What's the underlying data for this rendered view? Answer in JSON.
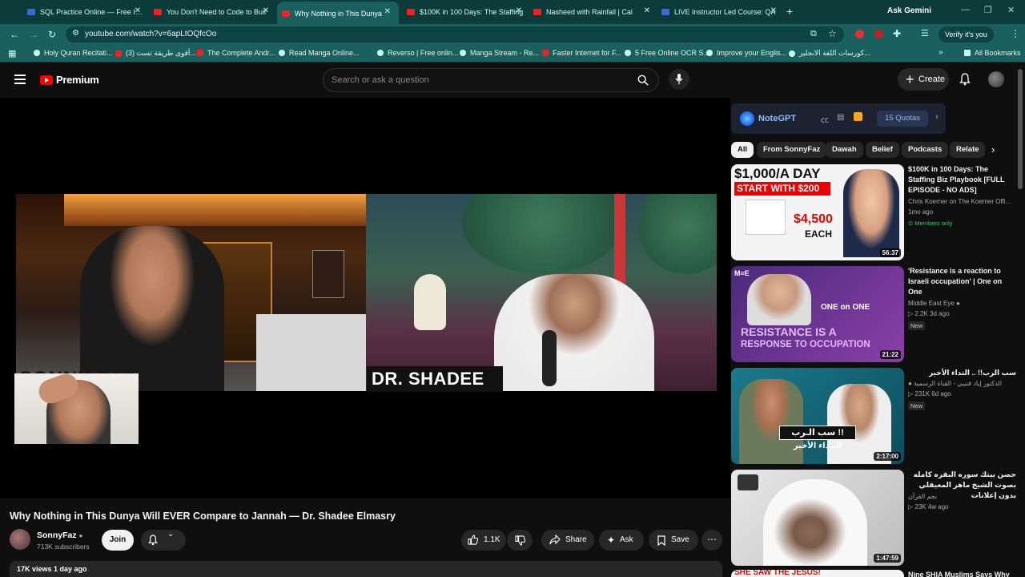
{
  "browser": {
    "tabs": [
      {
        "title": "SQL Practice Online — Free Inte",
        "fav": "blue"
      },
      {
        "title": "You Don't Need to Code to Buil",
        "fav": "red"
      },
      {
        "title": "Why Nothing in This Dunya",
        "fav": "red",
        "active": true
      },
      {
        "title": "$100K in 100 Days: The Staffing",
        "fav": "red"
      },
      {
        "title": "Nasheed with Rainfall | Cal",
        "fav": "red"
      },
      {
        "title": "LIVE Instructor Led Course: QA",
        "fav": "blue"
      }
    ],
    "new_tab": "+",
    "ask_gemini": "Ask Gemini",
    "url": "youtube.com/watch?v=6apLtOQfcOo",
    "verify": "Verify it's you",
    "bookmarks": [
      "Holy Quran Recitati...",
      "(3) أقوى طريقة تست...",
      "The Complete Andr...",
      "Read Manga Online...",
      "Reverso | Free onlin...",
      "Manga Stream - Re...",
      "Faster Internet for F...",
      "5 Free Online OCR S...",
      "Improve your Englis...",
      "كورسات اللغة الانجليز..."
    ],
    "all_bookmarks": "All Bookmarks"
  },
  "header": {
    "logo": "Premium",
    "search_placeholder": "Search or ask a question",
    "create": "Create"
  },
  "video": {
    "name_left": "SONNY FAZ",
    "name_right": "DR. SHADEE",
    "title": "Why Nothing in This Dunya Will EVER Compare to Jannah — Dr. Shadee Elmasry",
    "channel": "SonnyFaz",
    "subscribers": "713K subscribers",
    "join": "Join",
    "likes": "1.1K",
    "share": "Share",
    "ask": "Ask",
    "save": "Save",
    "stats": "17K views  1 day ago"
  },
  "notegpt": {
    "name": "NoteGPT",
    "quotas": "15 Quotas"
  },
  "chips": [
    "All",
    "From SonnyFaz",
    "Dawah",
    "Belief",
    "Podcasts",
    "Relate"
  ],
  "recommendations": [
    {
      "thumb_text_1": "$1,000/A DAY",
      "thumb_text_2": "START WITH $200",
      "thumb_text_3": "$4,500",
      "thumb_text_4": "EACH",
      "duration": "56:37",
      "title": "$100K in 100 Days: The Staffing Biz Playbook [FULL EPISODE - NO ADS]",
      "channel": "Chris Koerner on The Koerner Offi...",
      "meta": "1mo ago",
      "badge": "Members only"
    },
    {
      "thumb_text_1": "ONE on ONE",
      "thumb_text_2": "RESISTANCE IS A",
      "thumb_text_3": "RESPONSE TO OCCUPATION",
      "thumb_logo": "M≡E",
      "duration": "21:22",
      "title": "'Resistance is a reaction to Israeli occupation' | One on One",
      "channel": "Middle East Eye",
      "meta": "2.2K  3d ago",
      "badge": "New"
    },
    {
      "thumb_text_1": "سب الـرب !!",
      "thumb_text_2": "النـداء الأخير",
      "duration": "2:17:00",
      "title": "سب الرب!! .. النداء الأخير",
      "channel": "الدكتور إياد قنيبي - القناة الرسمية",
      "meta": "231K  6d ago",
      "badge": "New"
    },
    {
      "duration": "1:47:59",
      "title": "حصن بيتك سوره البقره كامله بصوت الشيخ ماهر المعيقلي بدون إعلانات",
      "channel": "نجم القرآن",
      "meta": "23K  4w ago"
    }
  ],
  "next_rec_partial": {
    "thumb_text": "SHE SAW THE JESUS!",
    "title": "Nine SHIA Muslims Says Why"
  }
}
